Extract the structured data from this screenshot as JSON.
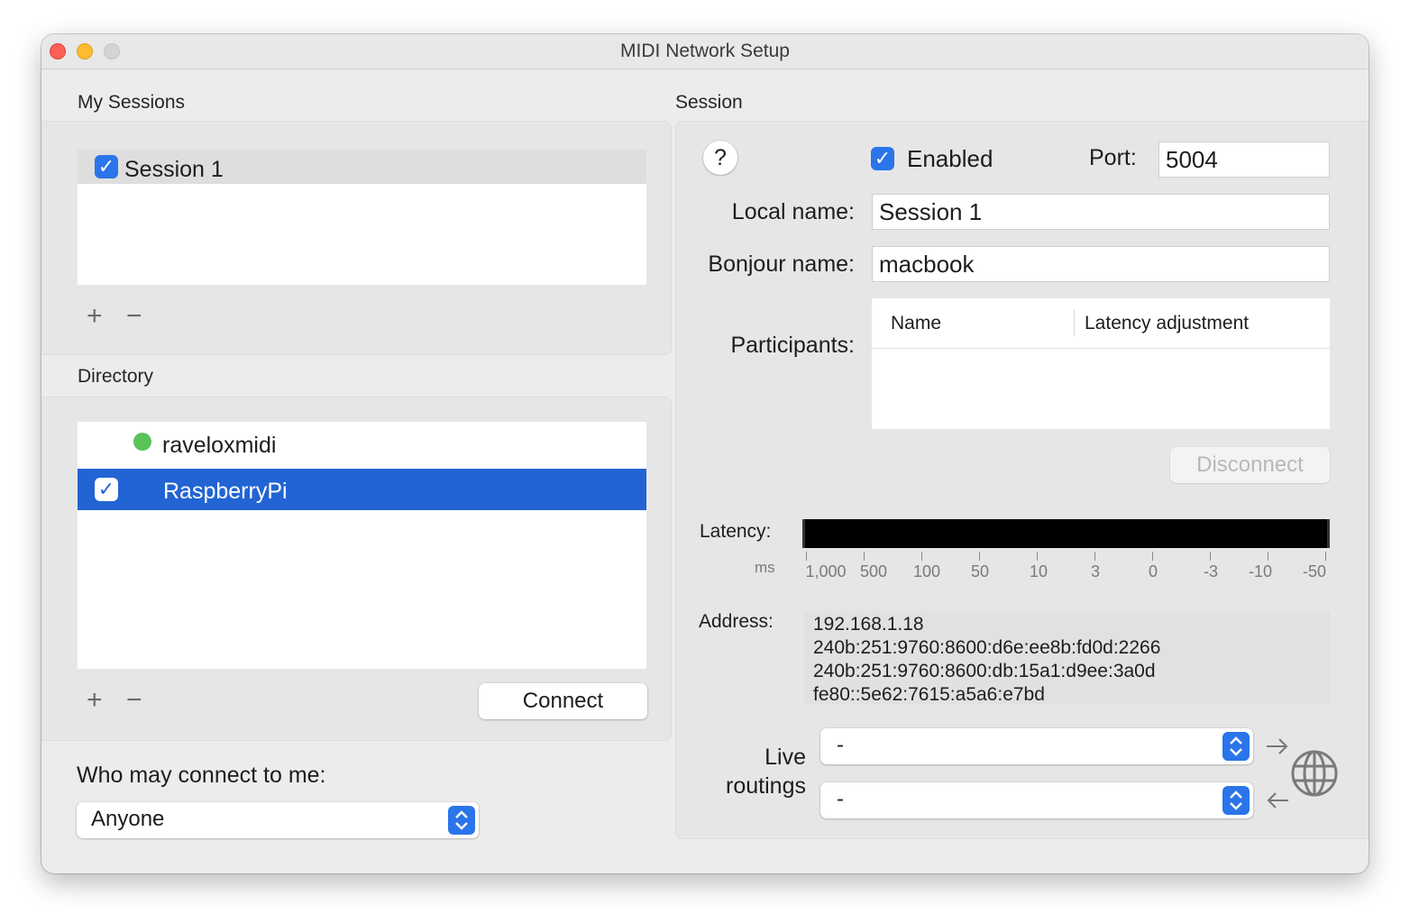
{
  "window": {
    "title": "MIDI Network Setup"
  },
  "my_sessions": {
    "label": "My Sessions",
    "items": [
      {
        "name": "Session 1",
        "checked": true
      }
    ],
    "add": "+",
    "remove": "−"
  },
  "directory": {
    "label": "Directory",
    "items": [
      {
        "name": "raveloxmidi",
        "status": "online"
      },
      {
        "name": "RaspberryPi",
        "checked": true,
        "selected": true
      }
    ],
    "add": "+",
    "remove": "−",
    "connect_label": "Connect"
  },
  "who_may_connect": {
    "label": "Who may connect to me:",
    "value": "Anyone"
  },
  "session": {
    "label": "Session",
    "help": "?",
    "enabled_label": "Enabled",
    "port_label": "Port:",
    "port_value": "5004",
    "local_name_label": "Local name:",
    "local_name_value": "Session 1",
    "bonjour_name_label": "Bonjour name:",
    "bonjour_name_value": "macbook",
    "participants_label": "Participants:",
    "participants_columns": [
      "Name",
      "Latency adjustment"
    ],
    "disconnect_label": "Disconnect",
    "latency_label": "Latency:",
    "latency_unit": "ms",
    "latency_ticks": [
      "1,000",
      "500",
      "100",
      "50",
      "10",
      "3",
      "0",
      "-3",
      "-10",
      "-50"
    ],
    "address_label": "Address:",
    "addresses": [
      "192.168.1.18",
      "240b:251:9760:8600:d6e:ee8b:fd0d:2266",
      "240b:251:9760:8600:db:15a1:d9ee:3a0d",
      "fe80::5e62:7615:a5a6:e7bd"
    ],
    "live_routings_label_1": "Live",
    "live_routings_label_2": "routings",
    "routing_out_value": "-",
    "routing_in_value": "-"
  },
  "colors": {
    "accent": "#2a75ea",
    "selection": "#2264d4",
    "online": "#5ac35a"
  }
}
